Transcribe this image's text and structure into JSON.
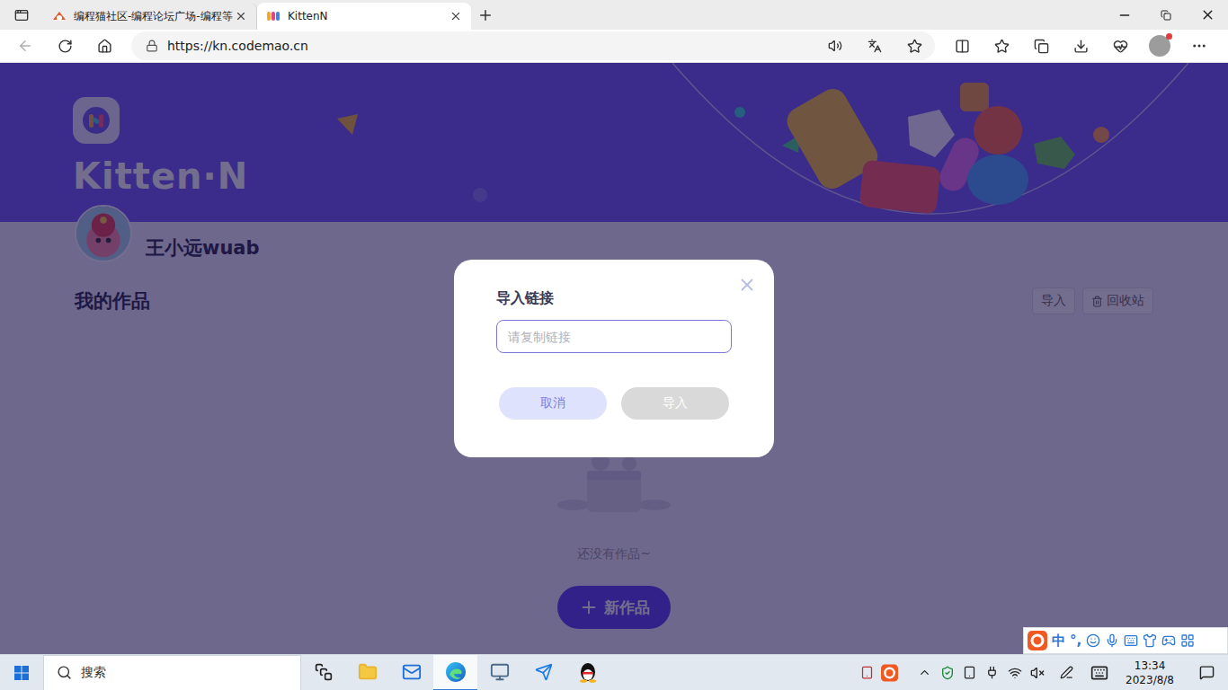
{
  "browser": {
    "tabs": [
      {
        "label": "编程猫社区-编程论坛广场-编程等",
        "selected": false
      },
      {
        "label": "KittenN",
        "selected": true
      }
    ],
    "url": "https://kn.codemao.cn"
  },
  "page": {
    "logo": "Kitten·N",
    "user": "王小远wuab",
    "section_title": "我的作品",
    "actions": [
      {
        "label": "导入",
        "kind": "plain"
      },
      {
        "label": "回收站",
        "kind": "trash"
      }
    ],
    "empty_text": "还没有作品~",
    "new_button": "新作品"
  },
  "dialog": {
    "title": "导入链接",
    "placeholder": "请复制链接",
    "value": "",
    "buttons": [
      {
        "label": "取消",
        "kind": "secondary",
        "disabled": false
      },
      {
        "label": "导入",
        "kind": "primary",
        "disabled": true
      }
    ]
  },
  "taskbar": {
    "search_placeholder": "搜索",
    "apps": [
      {
        "selected": false
      },
      {
        "selected": false
      },
      {
        "selected": false
      },
      {
        "selected": true
      },
      {
        "selected": false
      },
      {
        "selected": false
      },
      {
        "selected": false
      }
    ],
    "time": "13:34",
    "date": "2023/8/8"
  },
  "ime": {
    "mode": "中",
    "punctuation": "°,"
  }
}
